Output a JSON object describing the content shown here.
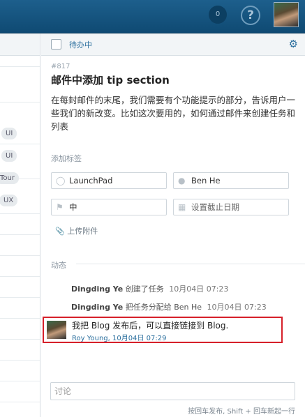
{
  "topbar": {
    "notifications": "0",
    "help_label": "?",
    "avatar": "user-avatar"
  },
  "left": {
    "tags": [
      "UI",
      "UI",
      "Tour",
      "UX"
    ]
  },
  "task": {
    "status": "待办中",
    "id": "#817",
    "title": "邮件中添加 tip section",
    "description": "在每封邮件的末尾，我们需要有个功能提示的部分，告诉用户一些我们的新改变。比如这次要用的，如何通过邮件来创建任务和列表",
    "add_tag_label": "添加标签",
    "project": "LaunchPad",
    "assignee": "Ben He",
    "priority": "中",
    "due_placeholder": "设置截止日期",
    "upload_label": "上传附件",
    "activity_label": "动态"
  },
  "activity": [
    {
      "user": "Dingding Ye",
      "action": "创建了任务",
      "time": "10月04日 07:23"
    },
    {
      "user": "Dingding Ye",
      "action": "把任务分配给 Ben He",
      "time": "10月04日 07:23"
    }
  ],
  "comment": {
    "text": "我把 Blog 发布后，可以直接链接到 Blog.",
    "meta": "Roy Young, 10月04日 07:29"
  },
  "discussion": {
    "placeholder": "讨论",
    "hint": "按回车发布, Shift + 回车新起一行"
  },
  "colors": {
    "topbar": "#1d5f8c",
    "accent": "#2b6f9e",
    "highlight_border": "#d6202a"
  }
}
